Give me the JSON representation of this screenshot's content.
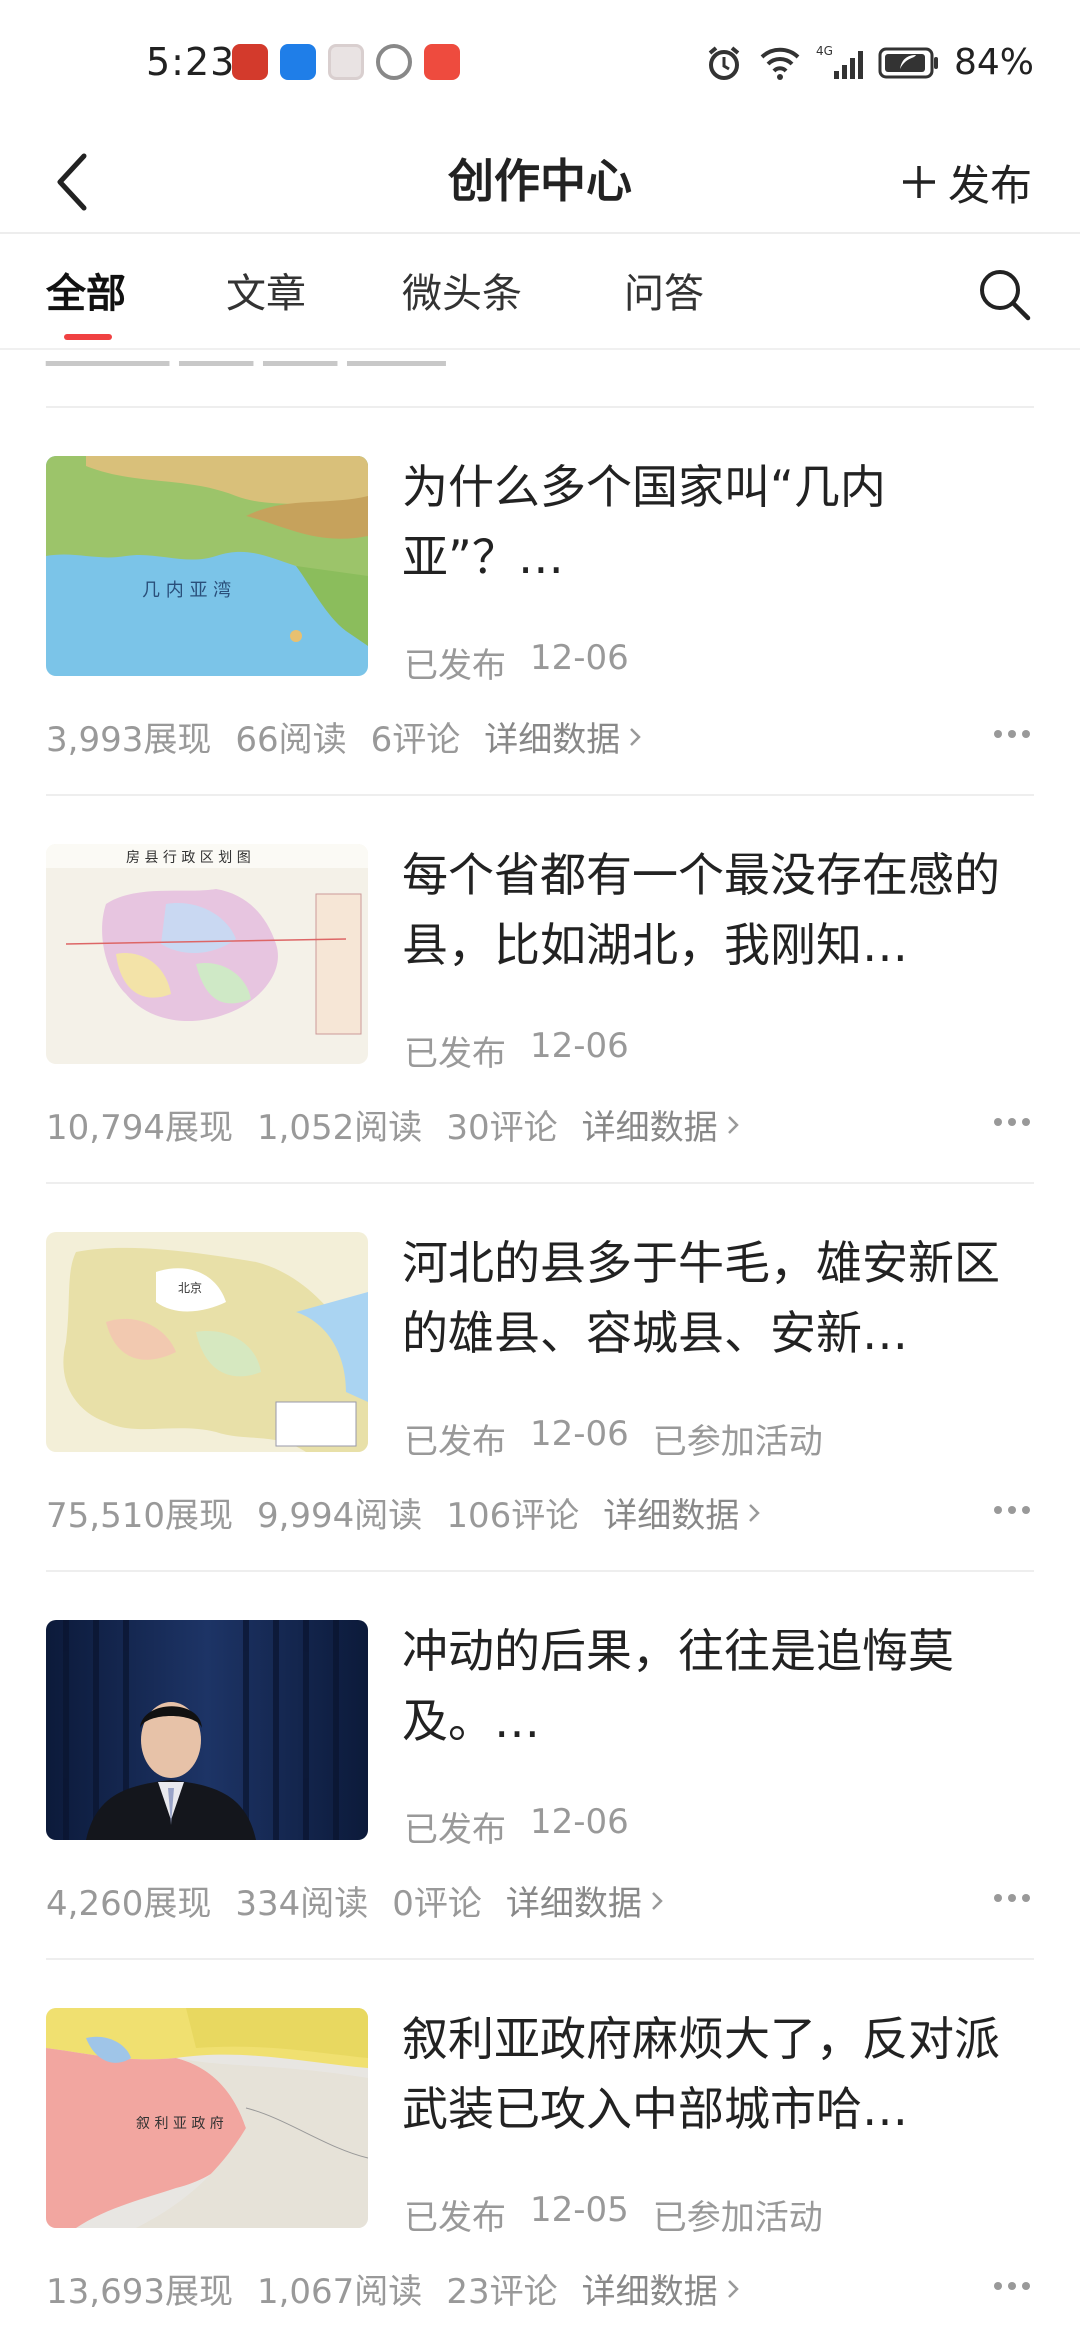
{
  "status_bar": {
    "time": "5:23",
    "battery": "84%",
    "network": "4G"
  },
  "header": {
    "title": "创作中心",
    "back_icon": "chevron-left-icon",
    "publish_label": "发布"
  },
  "tabs": [
    {
      "label": "全部",
      "active": true
    },
    {
      "label": "文章",
      "active": false
    },
    {
      "label": "微头条",
      "active": false
    },
    {
      "label": "问答",
      "active": false
    }
  ],
  "colors": {
    "accent": "#f04142",
    "text": "#222222",
    "muted": "#999999"
  },
  "detail_label": "详细数据",
  "articles": [
    {
      "title": "为什么多个国家叫“几内亚”？…",
      "status": "已发布",
      "date": "12-06",
      "activity": "",
      "views": "3,993展现",
      "reads": "66阅读",
      "comments": "6评论",
      "thumb_label": "几 内 亚 湾"
    },
    {
      "title": "每个省都有一个最没存在感的县，比如湖北，我刚知…",
      "status": "已发布",
      "date": "12-06",
      "activity": "",
      "views": "10,794展现",
      "reads": "1,052阅读",
      "comments": "30评论",
      "thumb_label": "房 县 行 政 区 划 图"
    },
    {
      "title": "河北的县多于牛毛，雄安新区的雄县、容城县、安新…",
      "status": "已发布",
      "date": "12-06",
      "activity": "已参加活动",
      "views": "75,510展现",
      "reads": "9,994阅读",
      "comments": "106评论",
      "thumb_label": "北京"
    },
    {
      "title": "冲动的后果，往往是追悔莫及。…",
      "status": "已发布",
      "date": "12-06",
      "activity": "",
      "views": "4,260展现",
      "reads": "334阅读",
      "comments": "0评论",
      "thumb_label": ""
    },
    {
      "title": "叙利亚政府麻烦大了，反对派武装已攻入中部城市哈…",
      "status": "已发布",
      "date": "12-05",
      "activity": "已参加活动",
      "views": "13,693展现",
      "reads": "1,067阅读",
      "comments": "23评论",
      "thumb_label": "叙 利 亚 政 府"
    }
  ]
}
